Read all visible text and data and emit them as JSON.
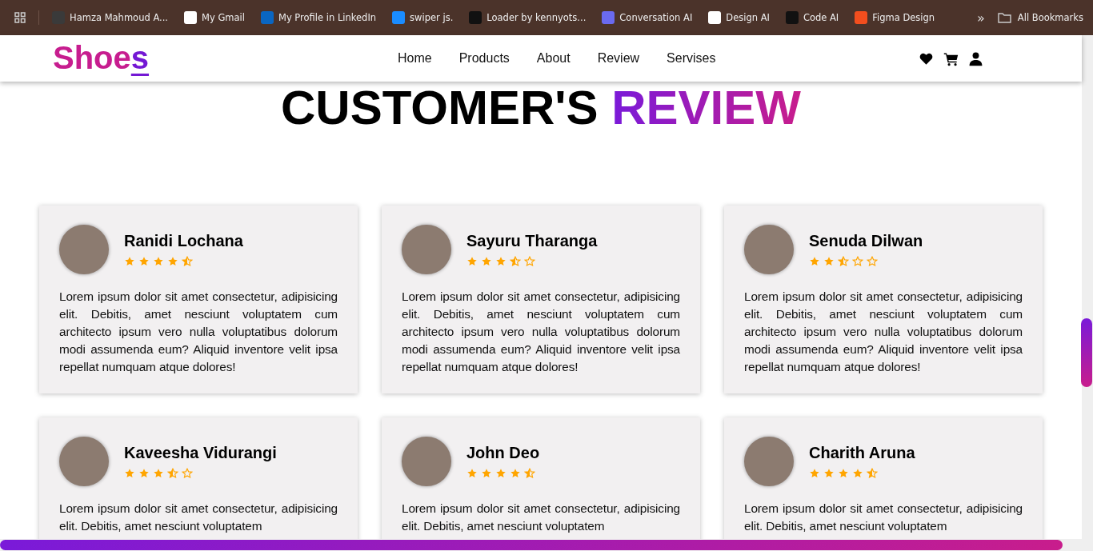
{
  "bookmarks_bar": {
    "items": [
      {
        "label": "Hamza Mahmoud A..."
      },
      {
        "label": "My Gmail"
      },
      {
        "label": "My Profile in LinkedIn"
      },
      {
        "label": "swiper js."
      },
      {
        "label": "Loader by kennyots..."
      },
      {
        "label": "Conversation AI"
      },
      {
        "label": "Design AI"
      },
      {
        "label": "Code AI"
      },
      {
        "label": "Figma Design"
      }
    ],
    "overflow": "»",
    "all_bookmarks": "All Bookmarks"
  },
  "navbar": {
    "logo_main": "Shoe",
    "logo_accent": "s",
    "links": [
      "Home",
      "Products",
      "About",
      "Review",
      "Servises"
    ]
  },
  "heading": {
    "main": "CUSTOMER'S",
    "accent": "REVIEW"
  },
  "reviews": [
    {
      "name": "Ranidi Lochana",
      "stars": 4.5,
      "text": "Lorem ipsum dolor sit amet consectetur, adipisicing elit. Debitis, amet nesciunt voluptatem cum architecto ipsum vero nulla voluptatibus dolorum modi assumenda eum? Aliquid inventore velit ipsa repellat numquam atque dolores!"
    },
    {
      "name": "Sayuru Tharanga",
      "stars": 3.5,
      "text": "Lorem ipsum dolor sit amet consectetur, adipisicing elit. Debitis, amet nesciunt voluptatem cum architecto ipsum vero nulla voluptatibus dolorum modi assumenda eum? Aliquid inventore velit ipsa repellat numquam atque dolores!"
    },
    {
      "name": "Senuda Dilwan",
      "stars": 2.5,
      "text": "Lorem ipsum dolor sit amet consectetur, adipisicing elit. Debitis, amet nesciunt voluptatem cum architecto ipsum vero nulla voluptatibus dolorum modi assumenda eum? Aliquid inventore velit ipsa repellat numquam atque dolores!"
    },
    {
      "name": "Kaveesha Vidurangi",
      "stars": 3.5,
      "text": "Lorem ipsum dolor sit amet consectetur, adipisicing elit. Debitis, amet nesciunt voluptatem"
    },
    {
      "name": "John Deo",
      "stars": 4.5,
      "text": "Lorem ipsum dolor sit amet consectetur, adipisicing elit. Debitis, amet nesciunt voluptatem"
    },
    {
      "name": "Charith Aruna",
      "stars": 4.5,
      "text": "Lorem ipsum dolor sit amet consectetur, adipisicing elit. Debitis, amet nesciunt voluptatem"
    }
  ]
}
